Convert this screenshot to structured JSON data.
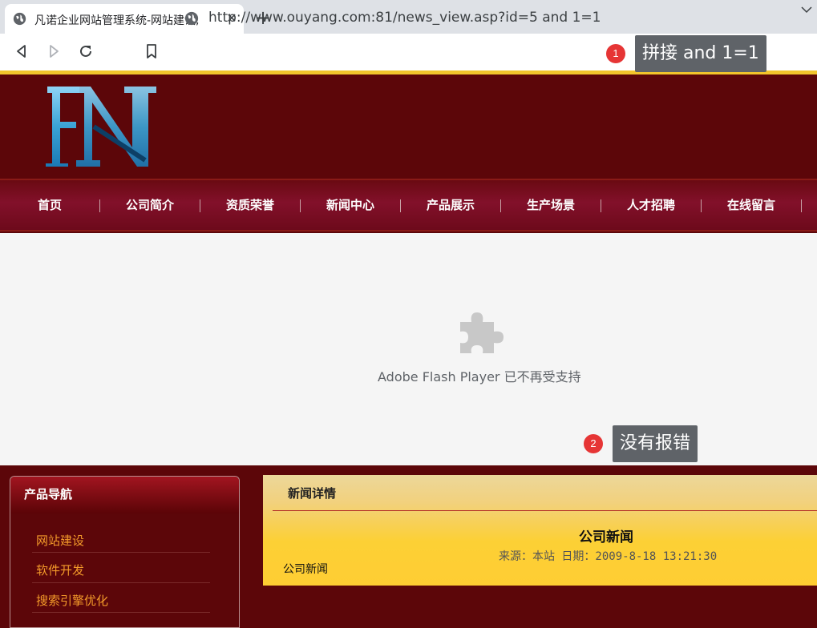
{
  "browser": {
    "tab_title": "凡诺企业网站管理系统-网站建设,",
    "tab_close": "✕",
    "new_tab": "+",
    "url": "http://www.ouyang.com:81/news_view.asp?id=5 and 1=1"
  },
  "annotations": [
    {
      "number": "1",
      "label": "拼接 and 1=1"
    },
    {
      "number": "2",
      "label": "没有报错"
    }
  ],
  "site": {
    "nav": [
      "首页",
      "公司简介",
      "资质荣誉",
      "新闻中心",
      "产品展示",
      "生产场景",
      "人才招聘",
      "在线留言"
    ],
    "flash_message": "Adobe Flash Player 已不再受支持",
    "sidebar": {
      "title": "产品导航",
      "items": [
        "网站建设",
        "软件开发",
        "搜索引擎优化"
      ]
    },
    "news": {
      "header": "新闻详情",
      "title": "公司新闻",
      "meta": "来源：本站 日期：2009-8-18 13:21:30",
      "body": "公司新闻"
    }
  },
  "colors": {
    "page_bg": "#5c0609",
    "accent_gold": "#f2c52c",
    "nav_text": "#ffffff",
    "sidebar_link": "#f39a2a",
    "annotation_red": "#e63535",
    "annotation_box": "#5f6368"
  },
  "icons": [
    "globe-icon",
    "close-icon",
    "plus-icon",
    "chevron-down-icon",
    "back-icon",
    "forward-icon",
    "reload-icon",
    "bookmark-icon",
    "site-info-icon",
    "plugin-icon",
    "logo-fn"
  ]
}
